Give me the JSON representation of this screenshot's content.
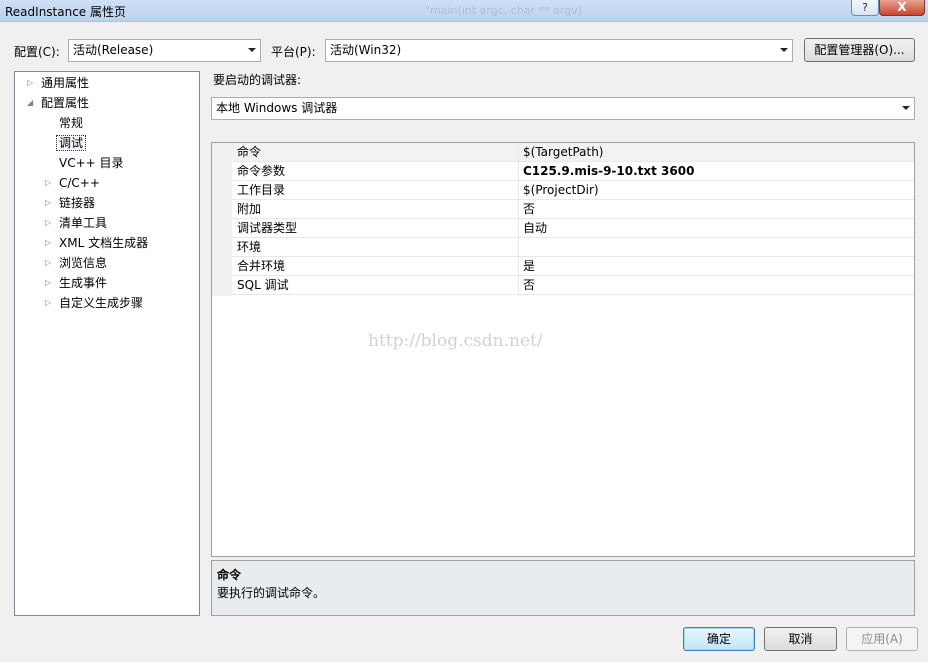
{
  "window": {
    "title": "ReadInstance 属性页",
    "ghost_title": "\"main(int argc, char ** argv)",
    "help": "?",
    "close": "X"
  },
  "toolbar": {
    "config_label": "配置(C):",
    "config_value": "活动(Release)",
    "platform_label": "平台(P):",
    "platform_value": "活动(Win32)",
    "config_manager": "配置管理器(O)..."
  },
  "tree": {
    "items": [
      {
        "label": "通用属性",
        "toggle": "▷"
      },
      {
        "label": "配置属性",
        "toggle": "◢"
      },
      {
        "label": "常规",
        "toggle": ""
      },
      {
        "label": "调试",
        "toggle": ""
      },
      {
        "label": "VC++ 目录",
        "toggle": ""
      },
      {
        "label": "C/C++",
        "toggle": "▷"
      },
      {
        "label": "链接器",
        "toggle": "▷"
      },
      {
        "label": "清单工具",
        "toggle": "▷"
      },
      {
        "label": "XML 文档生成器",
        "toggle": "▷"
      },
      {
        "label": "浏览信息",
        "toggle": "▷"
      },
      {
        "label": "生成事件",
        "toggle": "▷"
      },
      {
        "label": "自定义生成步骤",
        "toggle": "▷"
      }
    ]
  },
  "debugger": {
    "label": "要启动的调试器:",
    "value": "本地 Windows 调试器"
  },
  "grid": {
    "rows": [
      {
        "name": "命令",
        "value": "$(TargetPath)"
      },
      {
        "name": "命令参数",
        "value": "C125.9.mis-9-10.txt 3600"
      },
      {
        "name": "工作目录",
        "value": "$(ProjectDir)"
      },
      {
        "name": "附加",
        "value": "否"
      },
      {
        "name": "调试器类型",
        "value": "自动"
      },
      {
        "name": "环境",
        "value": ""
      },
      {
        "name": "合并环境",
        "value": "是"
      },
      {
        "name": "SQL 调试",
        "value": "否"
      }
    ]
  },
  "watermark": "http://blog.csdn.net/",
  "description": {
    "title": "命令",
    "text": "要执行的调试命令。"
  },
  "buttons": {
    "ok": "确定",
    "cancel": "取消",
    "apply": "应用(A)"
  }
}
